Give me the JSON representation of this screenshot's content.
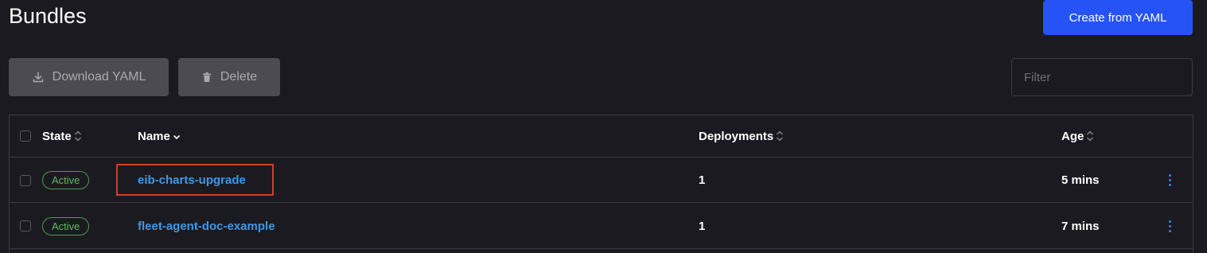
{
  "header": {
    "title": "Bundles",
    "create_label": "Create from YAML"
  },
  "toolbar": {
    "download_label": "Download YAML",
    "delete_label": "Delete",
    "filter_placeholder": "Filter"
  },
  "table": {
    "columns": [
      "State",
      "Name",
      "Deployments",
      "Age"
    ],
    "rows": [
      {
        "state": "Active",
        "name": "eib-charts-upgrade",
        "deployments": "1",
        "age": "5 mins",
        "highlighted": true
      },
      {
        "state": "Active",
        "name": "fleet-agent-doc-example",
        "deployments": "1",
        "age": "7 mins",
        "highlighted": false
      }
    ]
  },
  "colors": {
    "background": "#1b1a20",
    "primary": "#2553f5",
    "link": "#3d98e8",
    "active": "#5dbb5f",
    "highlight": "#d93a2e"
  },
  "icons": {
    "download": "download-icon",
    "delete": "trash-icon",
    "sort": "sort-icon",
    "actions": "kebab-menu-icon"
  }
}
